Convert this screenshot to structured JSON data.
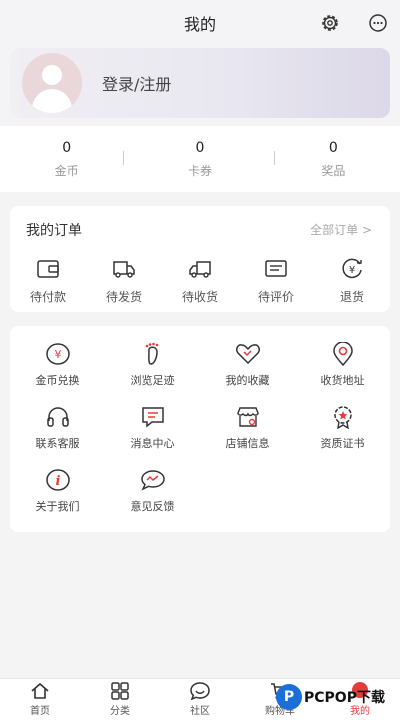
{
  "header": {
    "title": "我的"
  },
  "profile": {
    "login_label": "登录/注册"
  },
  "stats": [
    {
      "value": "0",
      "label": "金币"
    },
    {
      "value": "0",
      "label": "卡券"
    },
    {
      "value": "0",
      "label": "奖品"
    }
  ],
  "orders": {
    "title": "我的订单",
    "all_label": "全部订单 >",
    "items": [
      {
        "label": "待付款",
        "icon": "wallet-icon"
      },
      {
        "label": "待发货",
        "icon": "truck-icon"
      },
      {
        "label": "待收货",
        "icon": "delivery-truck-icon"
      },
      {
        "label": "待评价",
        "icon": "comment-icon"
      },
      {
        "label": "退货",
        "icon": "yen-return-icon"
      }
    ]
  },
  "services": [
    {
      "label": "金币兑换",
      "icon": "yen-coin-icon"
    },
    {
      "label": "浏览足迹",
      "icon": "footprint-icon"
    },
    {
      "label": "我的收藏",
      "icon": "heart-icon"
    },
    {
      "label": "收货地址",
      "icon": "location-icon"
    },
    {
      "label": "联系客服",
      "icon": "headset-icon"
    },
    {
      "label": "消息中心",
      "icon": "message-icon"
    },
    {
      "label": "店铺信息",
      "icon": "store-icon"
    },
    {
      "label": "资质证书",
      "icon": "certificate-icon"
    },
    {
      "label": "关于我们",
      "icon": "info-icon"
    },
    {
      "label": "意见反馈",
      "icon": "feedback-icon"
    }
  ],
  "tabs": [
    {
      "label": "首页",
      "icon": "home-icon"
    },
    {
      "label": "分类",
      "icon": "category-icon"
    },
    {
      "label": "社区",
      "icon": "community-icon"
    },
    {
      "label": "购物车",
      "icon": "cart-icon"
    },
    {
      "label": "我的",
      "icon": "mine-icon",
      "active": true
    }
  ],
  "watermark": {
    "logo": "P",
    "text": "PCPOP下载"
  },
  "colors": {
    "accent": "#e53b3b",
    "page_bg": "#f4f4f4"
  }
}
